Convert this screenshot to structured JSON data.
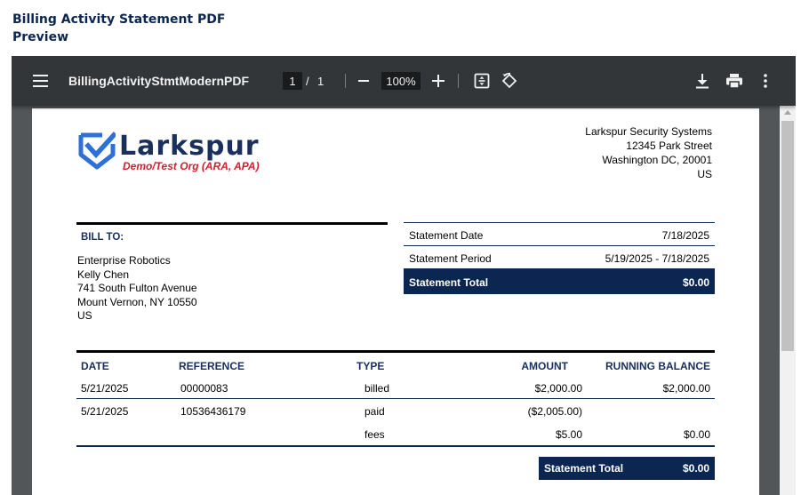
{
  "page": {
    "heading": "Billing Activity Statement PDF Preview"
  },
  "viewer": {
    "doc_title": "BillingActivityStmtModernPDF",
    "current_page": "1",
    "page_separator": "/",
    "total_pages": "1",
    "zoom": "100%",
    "icons": {
      "menu": "menu-icon",
      "zoom_out": "minus-icon",
      "zoom_in": "plus-icon",
      "fit": "fit-page-icon",
      "rotate": "rotate-icon",
      "download": "download-icon",
      "print": "print-icon",
      "more": "more-vert-icon"
    },
    "colors": {
      "toolbar": "#323639",
      "background": "#525659"
    }
  },
  "statement": {
    "logo": {
      "name": "Larkspur",
      "subtitle": "Demo/Test Org (ARA, APA)"
    },
    "company": {
      "name": "Larkspur Security Systems",
      "street": "12345 Park Street",
      "city": "Washington DC, 20001",
      "country": "US"
    },
    "bill_to": {
      "label": "BILL TO:",
      "lines": [
        "Enterprise Robotics",
        "Kelly Chen",
        "741 South Fulton Avenue",
        "Mount Vernon, NY 10550",
        "US"
      ]
    },
    "summary": {
      "statement_date_label": "Statement Date",
      "statement_date": "7/18/2025",
      "statement_period_label": "Statement Period",
      "statement_period": "5/19/2025 - 7/18/2025",
      "statement_total_label": "Statement Total",
      "statement_total": "$0.00"
    },
    "table": {
      "headers": {
        "date": "DATE",
        "reference": "REFERENCE",
        "type": "TYPE",
        "amount": "AMOUNT",
        "running_balance": "RUNNING BALANCE"
      },
      "rows": [
        {
          "date": "5/21/2025",
          "reference": "00000083",
          "type": "billed",
          "amount": "$2,000.00",
          "running_balance": "$2,000.00"
        },
        {
          "date": "5/21/2025",
          "reference": "10536436179",
          "type": "paid",
          "amount": "($2,005.00)",
          "running_balance": ""
        },
        {
          "date": "",
          "reference": "",
          "type": "fees",
          "amount": "$5.00",
          "running_balance": "$0.00"
        }
      ],
      "total_label": "Statement Total",
      "total_value": "$0.00"
    },
    "colors": {
      "navy": "#0b2650",
      "logo_red": "#d0202e",
      "logo_blue": "#2e6fd8"
    }
  }
}
